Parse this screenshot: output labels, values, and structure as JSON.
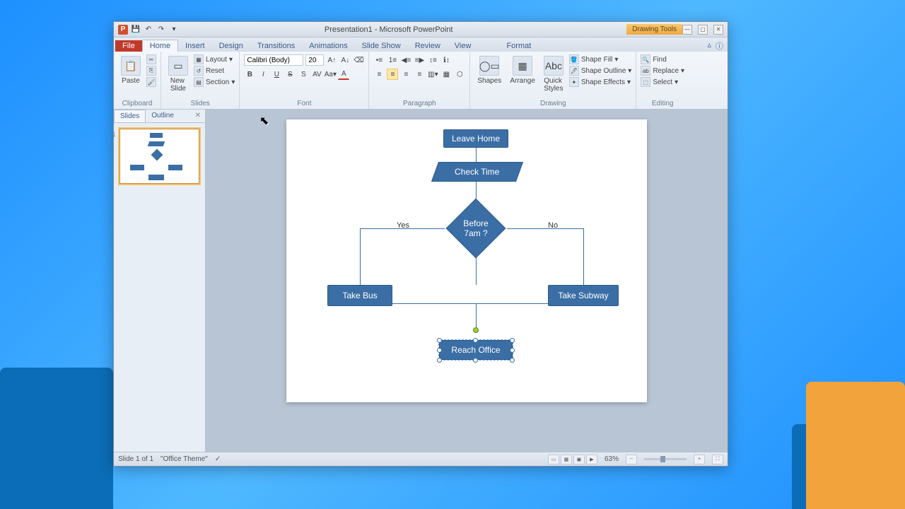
{
  "titlebar": {
    "title": "Presentation1 - Microsoft PowerPoint",
    "context_tab": "Drawing Tools"
  },
  "tabs": {
    "file": "File",
    "home": "Home",
    "insert": "Insert",
    "design": "Design",
    "transitions": "Transitions",
    "animations": "Animations",
    "slideshow": "Slide Show",
    "review": "Review",
    "view": "View",
    "format": "Format"
  },
  "ribbon": {
    "clipboard": {
      "label": "Clipboard",
      "paste": "Paste"
    },
    "slides": {
      "label": "Slides",
      "new_slide": "New\nSlide",
      "layout": "Layout",
      "reset": "Reset",
      "section": "Section"
    },
    "font": {
      "label": "Font",
      "name": "Calibri (Body)",
      "size": "20"
    },
    "paragraph": {
      "label": "Paragraph"
    },
    "drawing": {
      "label": "Drawing",
      "shapes": "Shapes",
      "arrange": "Arrange",
      "quick_styles": "Quick\nStyles",
      "fill": "Shape Fill",
      "outline": "Shape Outline",
      "effects": "Shape Effects"
    },
    "editing": {
      "label": "Editing",
      "find": "Find",
      "replace": "Replace",
      "select": "Select"
    }
  },
  "side_panel": {
    "slides_tab": "Slides",
    "outline_tab": "Outline",
    "slide_num": "1"
  },
  "flowchart": {
    "leave_home": "Leave Home",
    "check_time": "Check Time",
    "decision": "Before\n7am ?",
    "yes": "Yes",
    "no": "No",
    "take_bus": "Take Bus",
    "take_subway": "Take Subway",
    "reach_office": "Reach Office"
  },
  "statusbar": {
    "slide_info": "Slide 1 of 1",
    "theme": "\"Office Theme\"",
    "zoom": "63%"
  }
}
